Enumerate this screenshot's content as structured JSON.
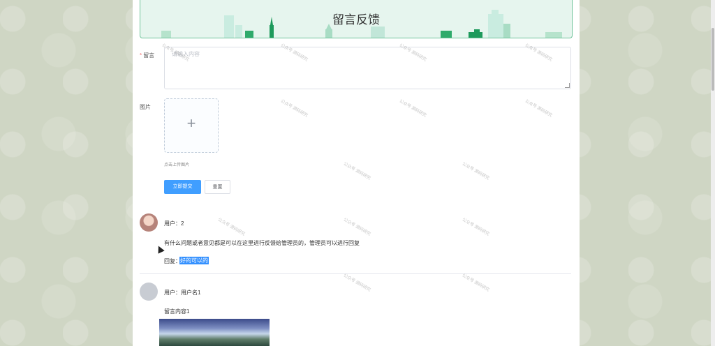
{
  "header": {
    "title": "留言反馈"
  },
  "form": {
    "message_label": "留言",
    "message_placeholder": "请输入内容",
    "image_label": "图片",
    "upload_plus": "+",
    "upload_tip": "点击上传图片",
    "submit_label": "立即提交",
    "reset_label": "重置"
  },
  "messages": [
    {
      "user": "用户：2",
      "content": "有什么问题或者意见都是可以在这里进行反馈给管理员的，管理员可以进行回复",
      "reply_label": "回复：",
      "reply_text": "好的可以的"
    },
    {
      "user": "用户：用户名1",
      "content": "留言内容1"
    }
  ],
  "watermark": "公众号 源码研究"
}
